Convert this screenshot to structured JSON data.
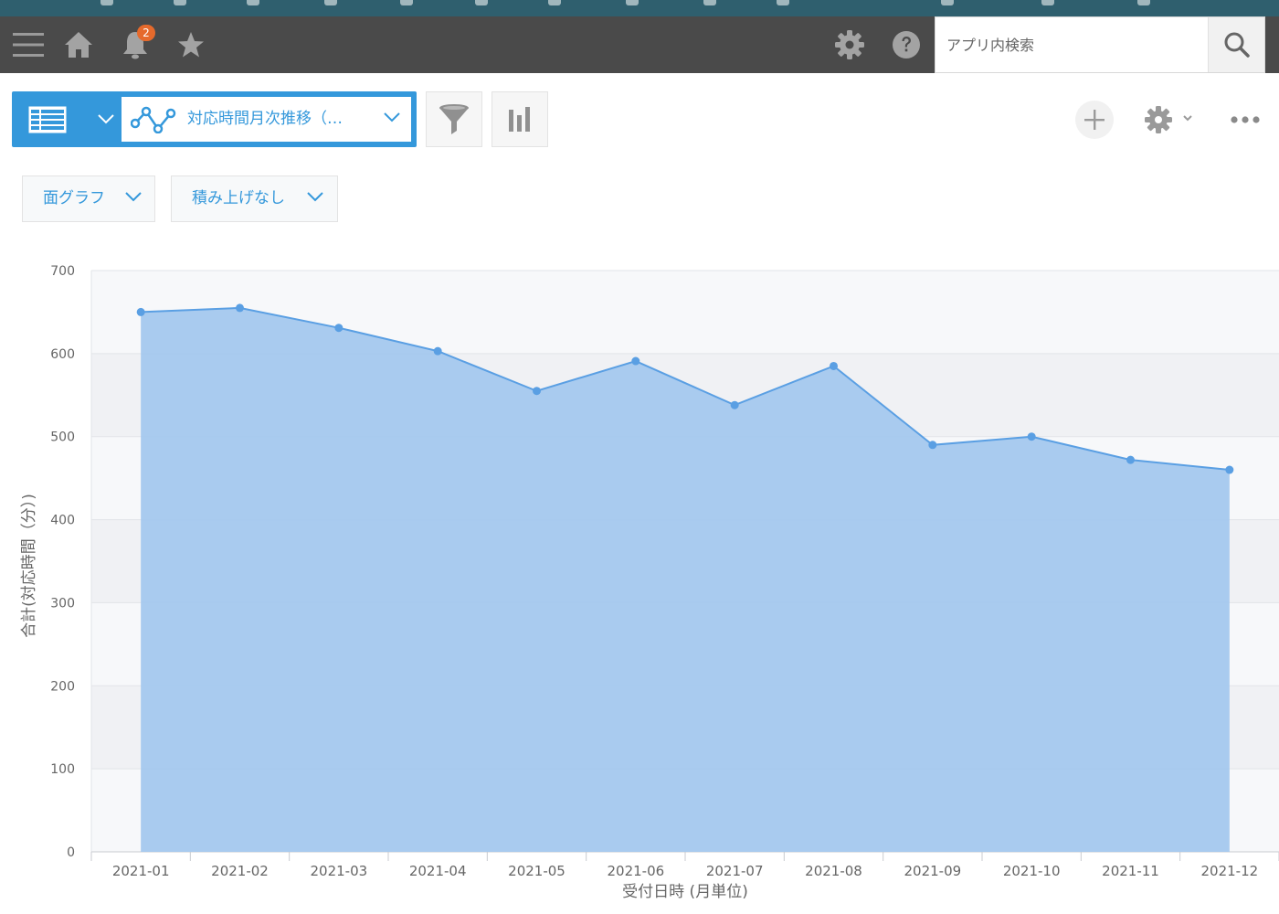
{
  "header": {
    "notification_count": "2",
    "search": {
      "placeholder": "アプリ内検索",
      "value": ""
    },
    "icons": [
      "menu-icon",
      "home-icon",
      "bell-icon",
      "star-icon",
      "gear-icon",
      "help-icon",
      "search-icon"
    ]
  },
  "toolbar": {
    "graph_name": "対応時間月次推移（…",
    "chart_type_label": "面グラフ",
    "stack_label": "積み上げなし"
  },
  "colors": {
    "header_bg": "#4a4a4a",
    "accent": "#3498db",
    "area_fill": "#a4c8ee",
    "line": "#5a9fe3",
    "badge": "#e66a2c"
  },
  "chart_data": {
    "type": "area",
    "categories": [
      "2021-01",
      "2021-02",
      "2021-03",
      "2021-04",
      "2021-05",
      "2021-06",
      "2021-07",
      "2021-08",
      "2021-09",
      "2021-10",
      "2021-11",
      "2021-12"
    ],
    "series": [
      {
        "values": [
          650,
          655,
          631,
          603,
          555,
          591,
          538,
          585,
          490,
          500,
          472,
          460
        ]
      }
    ],
    "xlabel": "受付日時 (月単位)",
    "ylabel": "合計(対応時間（分）)",
    "ylim": [
      0,
      700
    ],
    "yticks": [
      0,
      100,
      200,
      300,
      400,
      500,
      600,
      700
    ],
    "grid": true,
    "legend": "none"
  }
}
